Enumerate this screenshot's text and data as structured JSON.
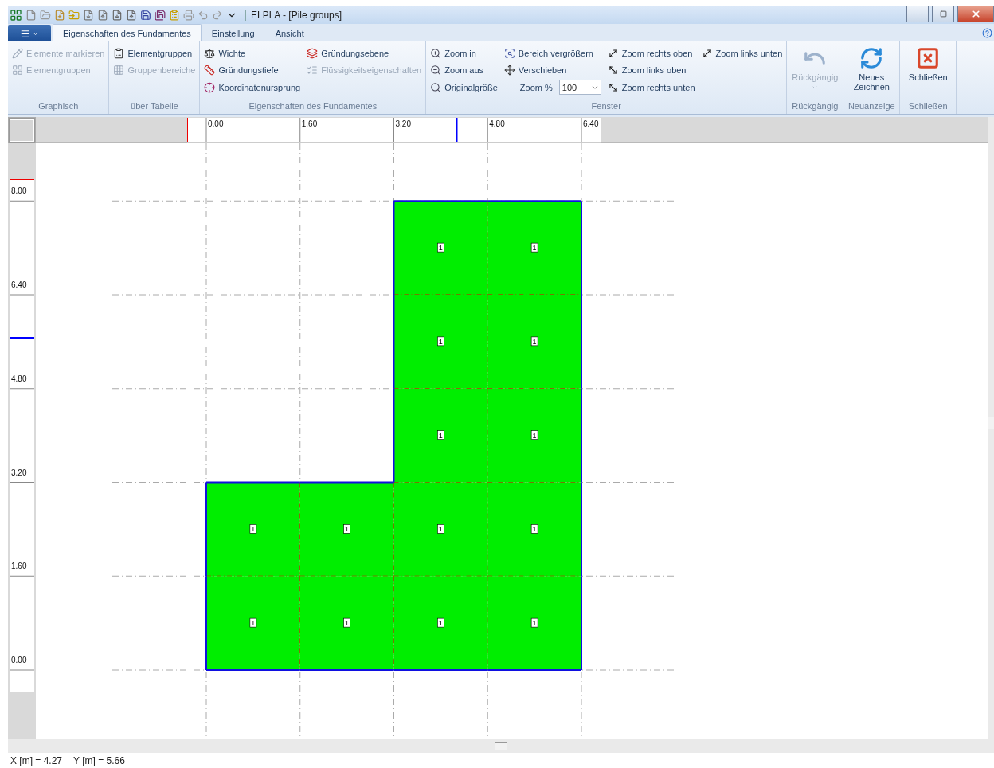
{
  "window": {
    "title": "ELPLA - [Pile groups]"
  },
  "tabs": [
    {
      "label": "Eigenschaften des Fundamentes",
      "selected": true
    },
    {
      "label": "Einstellung",
      "selected": false
    },
    {
      "label": "Ansicht",
      "selected": false
    }
  ],
  "ribbon": {
    "groups": [
      {
        "title": "Graphisch",
        "kind": "small",
        "items": [
          {
            "kind": "button",
            "label": "Elemente markieren",
            "disabled": true
          },
          {
            "kind": "button",
            "label": "Elementgruppen",
            "disabled": true
          }
        ]
      },
      {
        "title": "über Tabelle",
        "kind": "small",
        "items": [
          {
            "kind": "button",
            "label": "Elementgruppen",
            "disabled": false
          },
          {
            "kind": "button",
            "label": "Gruppenbereiche",
            "disabled": true
          }
        ]
      },
      {
        "title": "Eigenschaften des Fundamentes",
        "kind": "small",
        "items": [
          {
            "kind": "button",
            "label": "Wichte",
            "disabled": false
          },
          {
            "kind": "button",
            "label": "Gründungstiefe",
            "disabled": false
          },
          {
            "kind": "button",
            "label": "Koordinatenursprung",
            "disabled": false
          },
          {
            "kind": "button",
            "label": "Gründungsebene",
            "disabled": false
          },
          {
            "kind": "button",
            "label": "Flüssigkeitseigenschaften",
            "disabled": true
          }
        ]
      },
      {
        "title": "Fenster",
        "kind": "small",
        "items": [
          {
            "kind": "button",
            "label": "Zoom in",
            "disabled": false
          },
          {
            "kind": "button",
            "label": "Zoom aus",
            "disabled": false
          },
          {
            "kind": "button",
            "label": "Originalgröße",
            "disabled": false
          },
          {
            "kind": "button",
            "label": "Bereich vergrößern",
            "disabled": false
          },
          {
            "kind": "button",
            "label": "Verschieben",
            "disabled": false
          },
          {
            "kind": "zoom-field",
            "label": "Zoom %",
            "value": "100"
          },
          {
            "kind": "button",
            "label": "Zoom rechts oben",
            "disabled": false
          },
          {
            "kind": "button",
            "label": "Zoom links oben",
            "disabled": false
          },
          {
            "kind": "button",
            "label": "Zoom rechts unten",
            "disabled": false
          },
          {
            "kind": "button",
            "label": "Zoom links unten",
            "disabled": false
          }
        ]
      },
      {
        "title": "Rückgängig",
        "kind": "large",
        "items": [
          {
            "kind": "button",
            "label": "Rückgängig",
            "disabled": true
          }
        ]
      },
      {
        "title": "Neuanzeige",
        "kind": "large",
        "items": [
          {
            "kind": "button",
            "label": "Neues Zeichnen",
            "disabled": false
          }
        ]
      },
      {
        "title": "Schließen",
        "kind": "large",
        "items": [
          {
            "kind": "button",
            "label": "Schließen",
            "disabled": false
          }
        ]
      }
    ]
  },
  "canvas": {
    "x_ruler": [
      "0.00",
      "1.60",
      "3.20",
      "4.80",
      "6.40"
    ],
    "y_ruler": [
      "8.00",
      "6.40",
      "4.80",
      "3.20",
      "1.60",
      "0.00"
    ],
    "element_rows": [
      [
        null,
        null,
        "1",
        "1"
      ],
      [
        null,
        null,
        "1",
        "1"
      ],
      [
        null,
        null,
        "1",
        "1"
      ],
      [
        "1",
        "1",
        "1",
        "1"
      ],
      [
        "1",
        "1",
        "1",
        "1"
      ]
    ]
  },
  "status_bar": [
    "X [m] = 4.27",
    "Y [m] = 5.66"
  ]
}
